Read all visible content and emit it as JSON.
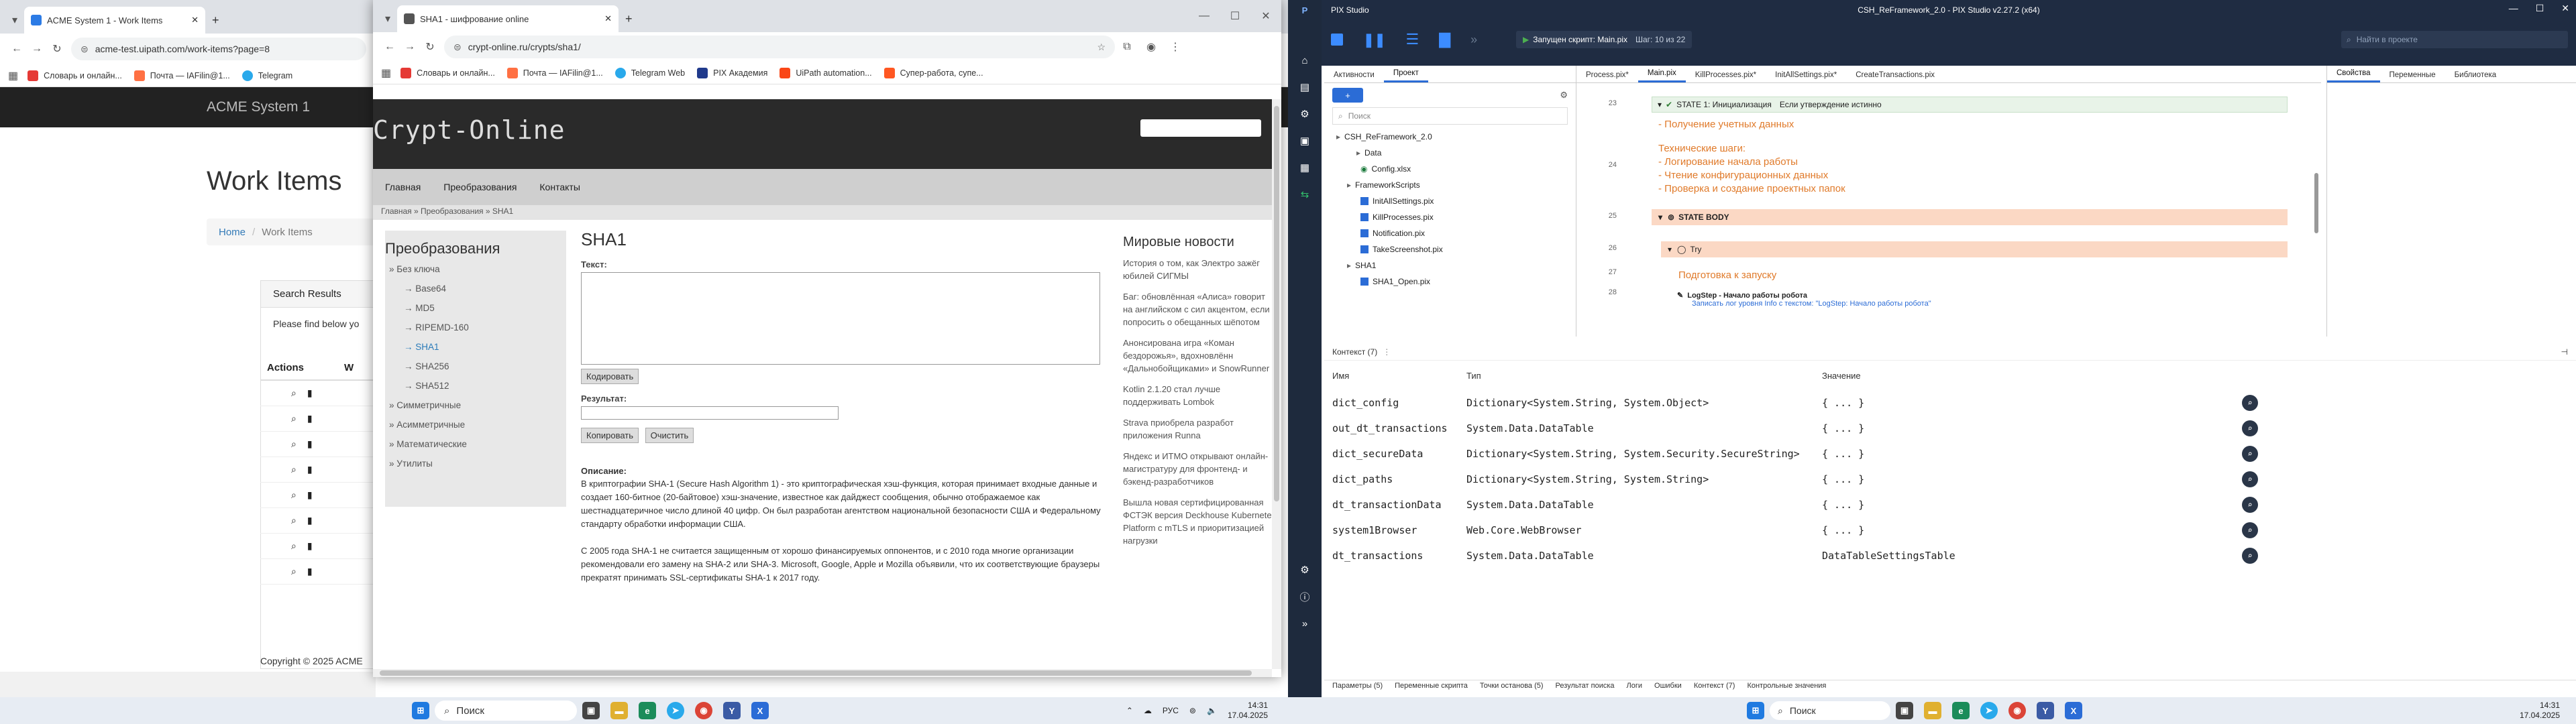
{
  "browser1": {
    "tab_title": "ACME System 1 - Work Items",
    "url": "acme-test.uipath.com/work-items?page=8",
    "bookmarks": [
      "Словарь и онлайн...",
      "Почта — IAFilin@1...",
      "Telegram"
    ],
    "brand": "ACME System 1",
    "page_title": "Work Items",
    "breadcrumb_home": "Home",
    "breadcrumb_current": "Work Items",
    "search_results_header": "Search Results",
    "find_text": "Please find below yo",
    "col_actions": "Actions",
    "col_w": "W",
    "rows": 8,
    "copyright": "Copyright © 2025 ACME"
  },
  "browser2": {
    "tab_title": "SHA1 - шифрование online",
    "url": "crypt-online.ru/crypts/sha1/",
    "bookmarks": [
      "Словарь и онлайн...",
      "Почта — IAFilin@1...",
      "Telegram Web",
      "PIX Академия",
      "UiPath automation...",
      "Супер-работа, супе..."
    ],
    "logo": "Crypt-Online",
    "menu": [
      "Главная",
      "Преобразования",
      "Контакты"
    ],
    "breadcrumb": "Главная » Преобразования » SHA1",
    "sidebar_title": "Преобразования",
    "sidebar_group1": "Без ключа",
    "sidebar_items": [
      "Base64",
      "MD5",
      "RIPEMD-160",
      "SHA1",
      "SHA256",
      "SHA512"
    ],
    "sidebar_groups": [
      "Симметричные",
      "Асимметричные",
      "Математические",
      "Утилиты"
    ],
    "heading": "SHA1",
    "text_label": "Текст:",
    "encode_button": "Кодировать",
    "result_label": "Результат:",
    "copy_button": "Копировать",
    "clear_button": "Очистить",
    "desc_label": "Описание:",
    "desc_p1": "В криптографии SHA-1 (Secure Hash Algorithm 1) - это криптографическая хэш-функция, которая принимает входные данные и создает 160-битное (20-байтовое) хэш-значение, известное как дайджест сообщения, обычно отображаемое как шестнадцатеричное число длиной 40 цифр. Он был разработан агентством национальной безопасности США и Федеральному стандарту обработки информации США.",
    "desc_p2": "С 2005 года SHA-1 не считается защищенным от хорошо финансируемых оппонентов, и с 2010 года многие организации рекомендовали его замену на SHA-2 или SHA-3. Microsoft, Google, Apple и Mozilla объявили, что их соответствующие браузеры прекратят принимать SSL-сертификаты SHA-1 к 2017 году.",
    "news_title": "Мировые новости",
    "news": [
      "История о том, как Электро зажёг юбилей СИГМЫ",
      "Баг: обновлённая «Алиса» говорит на английском с сил акцентом, если попросить о обещанных шёпотом",
      "Анонсирована игра «Коман бездорожья», вдохновлённ «Дальнобойщиками» и SnowRunner",
      "Kotlin 2.1.20 стал лучше поддерживать Lombok",
      "Strava приобрела разработ приложения Runna",
      "Яндекс и ИТМО открывают онлайн-магистратуру для фронтенд- и бэкенд-разработчиков",
      "Вышла новая сертифицированная ФСТЭК версия Deckhouse Kubernete Platform с mTLS и приоритизацией нагрузки"
    ]
  },
  "pix": {
    "title": "CSH_ReFramework_2.0 - PIX Studio v2.27.2 (x64)",
    "app_name": "PIX Studio",
    "status": "Запущен скрипт: Main.pix",
    "step": "Шаг: 10 из 22",
    "search_placeholder": "Найти в проекте",
    "left_tabs": [
      "Активности",
      "Проект"
    ],
    "project_search": "Поиск",
    "tree": [
      "CSH_ReFramework_2.0",
      "Data",
      "Config.xlsx",
      "FrameworkScripts",
      "InitAllSettings.pix",
      "KillProcesses.pix",
      "Notification.pix",
      "TakeScreenshot.pix",
      "SHA1",
      "SHA1_Open.pix"
    ],
    "doc_tabs": [
      "Process.pix*",
      "Main.pix",
      "KillProcesses.pix*",
      "InitAllSettings.pix*",
      "CreateTransactions.pix"
    ],
    "right_tabs": [
      "Свойства",
      "Переменные",
      "Библиотека"
    ],
    "line_numbers": [
      "23",
      "24",
      "25",
      "26",
      "27",
      "28"
    ],
    "state_title": "STATE 1: Инициализация",
    "state_cond": "Если утверждение истинно",
    "designer_lines": [
      "- Получение учетных данных",
      "Технические шаги:",
      "- Логирование начала работы",
      "- Чтение конфигурационных данных",
      "- Проверка и создание проектных папок"
    ],
    "state_body": "STATE BODY",
    "try_label": "Try",
    "prep_label": "Подготовка к запуску",
    "logstep_title": "LogStep - Начало работы робота",
    "logstep_desc": "Записать лог уровня Info с текстом: \"LogStep: Начало работы робота\"",
    "context_title": "Контекст (7)",
    "ctx_headers": [
      "Имя",
      "Тип",
      "Значение"
    ],
    "ctx_rows": [
      {
        "name": "dict_config",
        "type": "Dictionary<System.String, System.Object>",
        "value": "{ ... }"
      },
      {
        "name": "out_dt_transactions",
        "type": "System.Data.DataTable",
        "value": "{ ... }"
      },
      {
        "name": "dict_secureData",
        "type": "Dictionary<System.String, System.Security.SecureString>",
        "value": "{ ... }"
      },
      {
        "name": "dict_paths",
        "type": "Dictionary<System.String, System.String>",
        "value": "{ ... }"
      },
      {
        "name": "dt_transactionData",
        "type": "System.Data.DataTable",
        "value": "{ ... }"
      },
      {
        "name": "system1Browser",
        "type": "Web.Core.WebBrowser",
        "value": "{ ... }"
      },
      {
        "name": "dt_transactions",
        "type": "System.Data.DataTable",
        "value": "DataTableSettingsTable"
      }
    ],
    "bottom_tabs": [
      "Параметры (5)",
      "Переменные скрипта",
      "Точки останова (5)",
      "Результат поиска",
      "Логи",
      "Ошибки",
      "Контекст (7)",
      "Контрольные значения"
    ]
  },
  "taskbar": {
    "search": "Поиск",
    "lang": "РУС",
    "time": "14:31",
    "date": "17.04.2025",
    "time2": "14:31",
    "date2": "17.04.2025"
  }
}
